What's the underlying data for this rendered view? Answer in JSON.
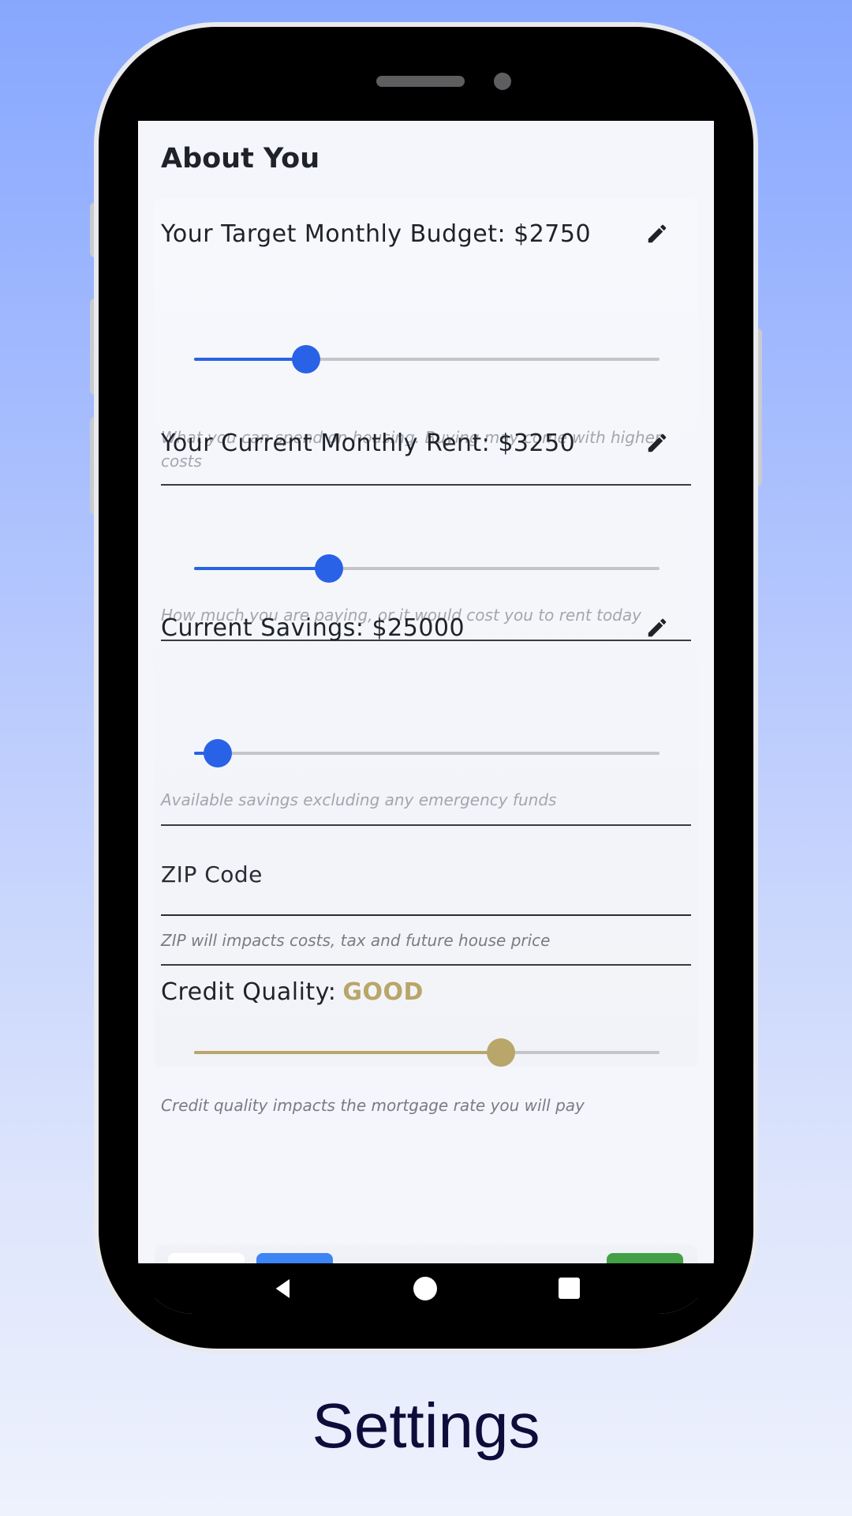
{
  "app": {
    "title": "About You",
    "accent_color": "#2962e6",
    "credit_color": "#b8a66a"
  },
  "budget": {
    "label": "Your Target Monthly Budget: $2750",
    "hint": "What you can spend on housing. Buying may come with higher costs",
    "slider_fraction": 0.24,
    "icon": "pencil-icon"
  },
  "rent": {
    "label": "Your Current Monthly Rent: $3250",
    "hint": "How much you are paying, or it would cost you to rent today",
    "slider_fraction": 0.29,
    "icon": "pencil-icon"
  },
  "savings": {
    "label": "Current Savings: $25000",
    "hint": "Available savings excluding any emergency funds",
    "slider_fraction": 0.05,
    "icon": "pencil-icon"
  },
  "zip": {
    "label": "ZIP Code",
    "hint": "ZIP will impacts costs, tax and future house price"
  },
  "credit": {
    "label": "Credit Quality:",
    "value": "GOOD",
    "hint": "Credit quality impacts the mortgage rate you will pay",
    "slider_fraction": 0.66
  },
  "nav": {
    "items": [
      {
        "icon": "return-arrow-icon",
        "active": false
      },
      {
        "icon": "person-icon",
        "active": true
      },
      {
        "icon": "document-icon",
        "active": false
      },
      {
        "icon": "home-icon",
        "active": false
      },
      {
        "icon": "bar-chart-icon",
        "active": false
      },
      {
        "icon": "play-icon",
        "active": false
      }
    ]
  },
  "caption": "Settings"
}
